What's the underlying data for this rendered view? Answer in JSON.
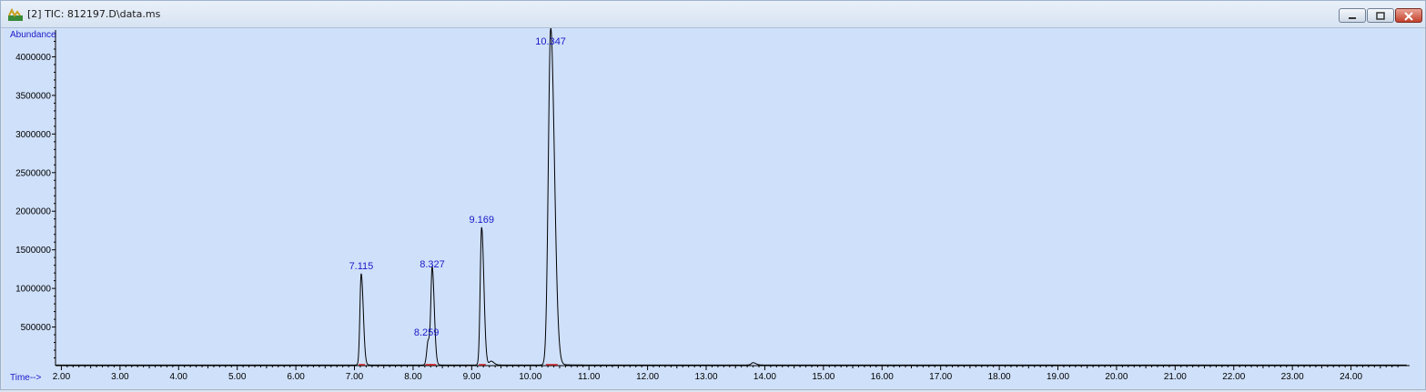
{
  "window": {
    "title": "[2] TIC: 812197.D\\data.ms",
    "icon": "chromatogram-app-icon",
    "controls": [
      "minimize-icon",
      "restore-icon",
      "close-icon"
    ]
  },
  "chart_data": {
    "type": "line",
    "ylabel": "Abundance",
    "xlabel": "Time-->",
    "xlim": [
      1.9,
      25.0
    ],
    "ylim": [
      0,
      4300000
    ],
    "grid": false,
    "x_ticks": [
      "2.00",
      "3.00",
      "4.00",
      "5.00",
      "6.00",
      "7.00",
      "8.00",
      "9.00",
      "10.00",
      "11.00",
      "12.00",
      "13.00",
      "14.00",
      "15.00",
      "16.00",
      "17.00",
      "18.00",
      "19.00",
      "20.00",
      "21.00",
      "22.00",
      "23.00",
      "24.00"
    ],
    "y_ticks": [
      "500000",
      "1000000",
      "1500000",
      "2000000",
      "2500000",
      "3000000",
      "3500000",
      "4000000"
    ],
    "peaks": [
      {
        "label": "7.115",
        "time": 7.115,
        "height": 1180000,
        "width": 0.022
      },
      {
        "label": "8.259",
        "time": 8.259,
        "height": 320000,
        "width": 0.025
      },
      {
        "label": "8.327",
        "time": 8.327,
        "height": 1200000,
        "width": 0.022
      },
      {
        "label": "9.169",
        "time": 9.169,
        "height": 1780000,
        "width": 0.024
      },
      {
        "label": "10.347",
        "time": 10.347,
        "height": 4350000,
        "width": 0.04
      }
    ],
    "minor_bumps": [
      {
        "time": 9.33,
        "height": 50000
      },
      {
        "time": 13.8,
        "height": 30000
      }
    ],
    "colors": {
      "trace": "#000000",
      "labels": "#1a1ac8",
      "baseline_marks": "#d02020",
      "background": "#cfe0fa"
    }
  }
}
